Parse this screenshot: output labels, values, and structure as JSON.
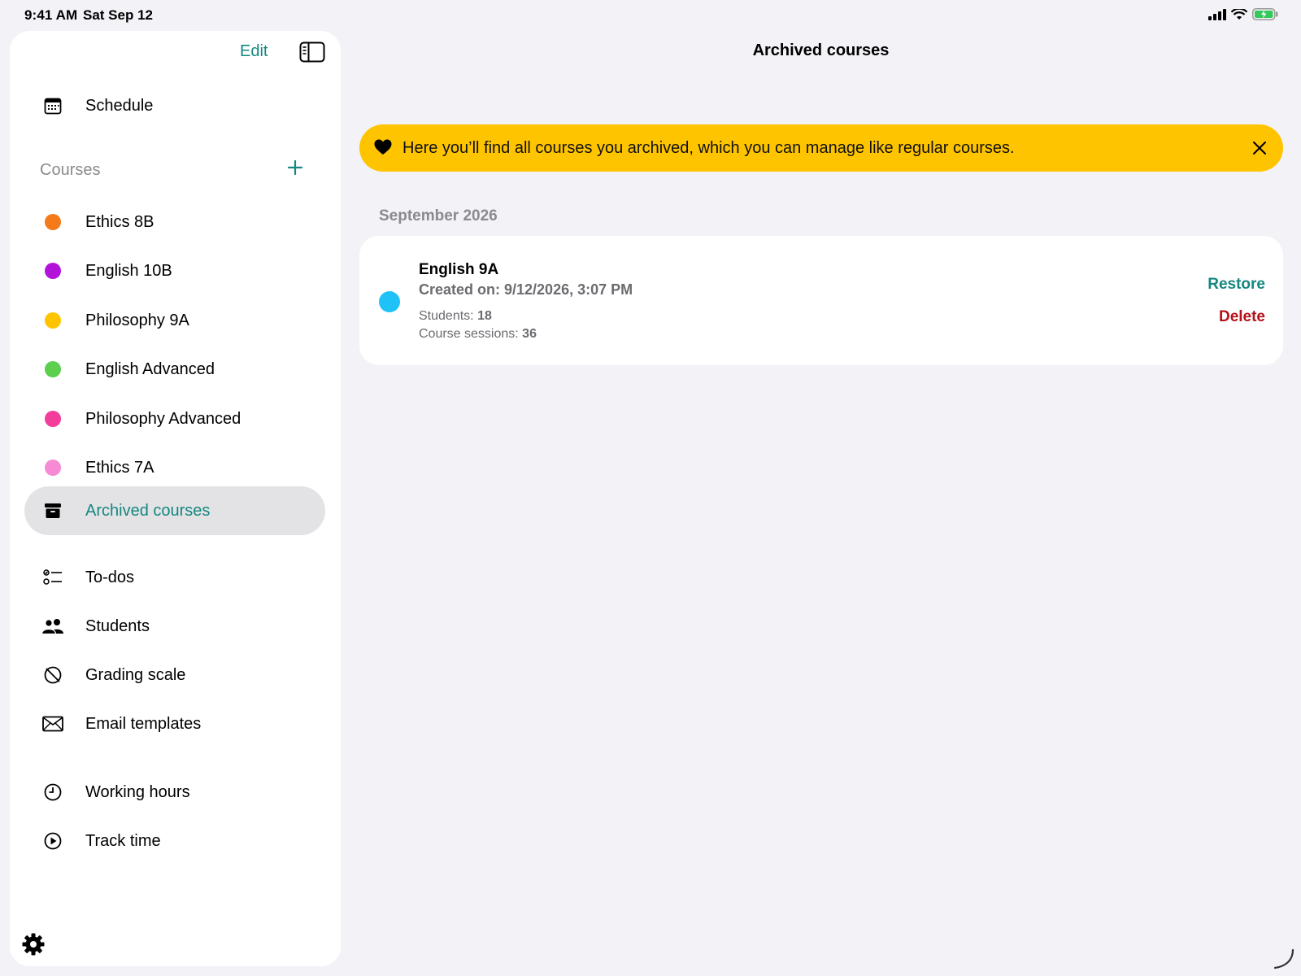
{
  "status_bar": {
    "time": "9:41 AM",
    "date": "Sat Sep 12"
  },
  "sidebar": {
    "edit_label": "Edit",
    "schedule_label": "Schedule",
    "courses_title": "Courses",
    "courses": [
      {
        "label": "Ethics 8B",
        "color": "#f57a1a"
      },
      {
        "label": "English 10B",
        "color": "#b313d9"
      },
      {
        "label": "Philosophy 9A",
        "color": "#ffc400"
      },
      {
        "label": "English Advanced",
        "color": "#5ccf4f"
      },
      {
        "label": "Philosophy Advanced",
        "color": "#f23d9a"
      },
      {
        "label": "Ethics 7A",
        "color": "#f78ad4"
      }
    ],
    "archived_label": "Archived courses",
    "tools": [
      {
        "label": "To-dos",
        "icon": "checklist-icon"
      },
      {
        "label": "Students",
        "icon": "people-icon"
      },
      {
        "label": "Grading scale",
        "icon": "grading-scale-icon"
      },
      {
        "label": "Email templates",
        "icon": "envelope-icon"
      }
    ],
    "time": [
      {
        "label": "Working hours",
        "icon": "clock-icon"
      },
      {
        "label": "Track time",
        "icon": "play-circle-icon"
      }
    ]
  },
  "main": {
    "title": "Archived courses",
    "banner_text": "Here you’ll find all courses you archived, which you can manage like regular courses.",
    "month": "September 2026",
    "course": {
      "name": "English 9A",
      "created": "Created on: 9/12/2026, 3:07 PM",
      "students_label": "Students:",
      "students_value": "18",
      "sessions_label": "Course sessions:",
      "sessions_value": "36",
      "color": "#1ec2f7",
      "restore_label": "Restore",
      "delete_label": "Delete"
    }
  },
  "colors": {
    "accent": "#14877f",
    "banner": "#ffc400",
    "delete": "#b5121b"
  }
}
